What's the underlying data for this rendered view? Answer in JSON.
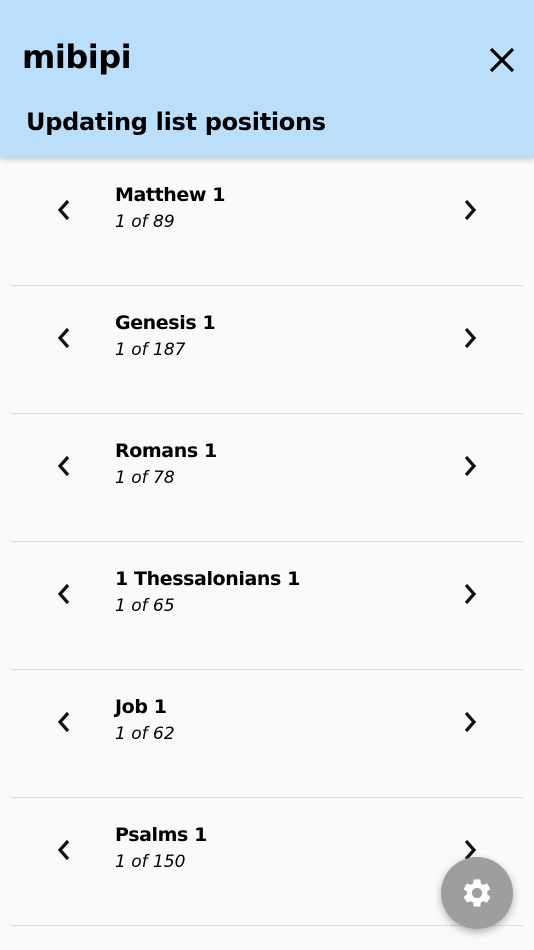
{
  "app": {
    "title": "mibipi",
    "subtitle": "Updating list positions"
  },
  "colors": {
    "app_bar": "#bbdefb",
    "fab": "#9e9e9e",
    "background": "#fafafa"
  },
  "icons": {
    "close": "close-icon",
    "previous": "chevron-left-icon",
    "next": "chevron-right-icon",
    "settings": "gear-icon"
  },
  "rows": [
    {
      "title": "Matthew 1",
      "count": "1 of 89"
    },
    {
      "title": "Genesis 1",
      "count": "1 of 187"
    },
    {
      "title": "Romans 1",
      "count": "1 of 78"
    },
    {
      "title": "1 Thessalonians 1",
      "count": "1 of 65"
    },
    {
      "title": "Job 1",
      "count": "1 of 62"
    },
    {
      "title": "Psalms 1",
      "count": "1 of 150"
    }
  ]
}
